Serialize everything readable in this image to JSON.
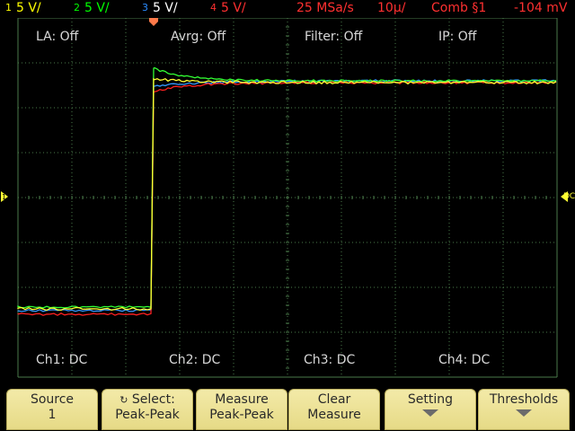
{
  "status": {
    "ch1": {
      "num": "1",
      "scale": "5 V/",
      "color": "#ffff00"
    },
    "ch2": {
      "num": "2",
      "scale": "5 V/",
      "color": "#00ff00"
    },
    "ch3": {
      "num": "3",
      "scale": "5 V/",
      "color": "#2a8cff"
    },
    "ch4": {
      "num": "4",
      "scale": "5 V/",
      "color": "#ff3030"
    },
    "sample_rate": "25 MSa/s",
    "timebase": "10µ/",
    "mode": "Comb §1",
    "trigger_level": "-104 mV",
    "accent": "#ff3030"
  },
  "overlays": {
    "la": "LA: Off",
    "avrg": "Avrg: Off",
    "filter": "Filter: Off",
    "ip": "IP: Off",
    "ch1": "Ch1: DC",
    "ch2": "Ch2: DC",
    "ch3": "Ch3: DC",
    "ch4": "Ch4: DC",
    "ground_marker": "1",
    "dc_marker": "DC"
  },
  "softkeys": [
    {
      "line1": "Source",
      "line2": "1"
    },
    {
      "line1": "Select:",
      "line2": "Peak-Peak"
    },
    {
      "line1": "Measure",
      "line2": "Peak-Peak"
    },
    {
      "line1": "Clear",
      "line2": "Measure"
    },
    {
      "line1": "Setting",
      "line2": ""
    },
    {
      "line1": "Thresholds",
      "line2": ""
    }
  ],
  "traces": {
    "colors": {
      "yellow": "#ffff33",
      "green": "#33ff33",
      "blue": "#3399ff",
      "red": "#ff2020"
    }
  }
}
